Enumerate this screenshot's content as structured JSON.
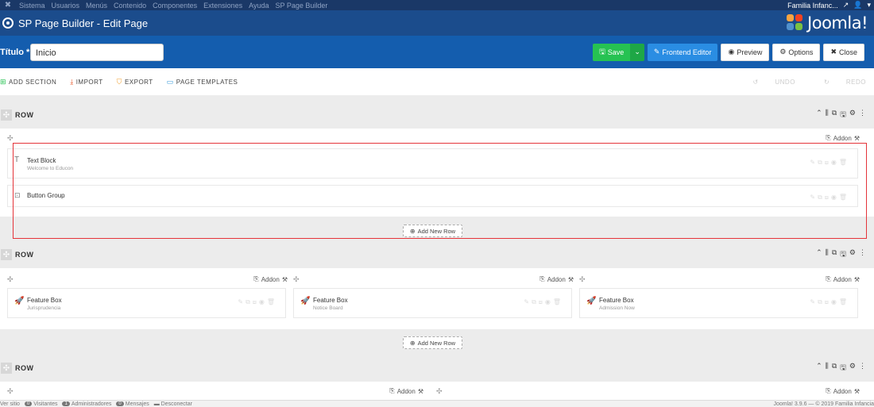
{
  "topmenu": {
    "items": [
      "Sistema",
      "Usuarios",
      "Menús",
      "Contenido",
      "Componentes",
      "Extensiones",
      "Ayuda",
      "SP Page Builder"
    ],
    "site_name": "Familia Infanc...",
    "user_icon": "user-icon"
  },
  "titlebar": {
    "title": "SP Page Builder - Edit Page",
    "logo_text": "Joomla!",
    "logo_colors": [
      "#f9a541",
      "#f44321",
      "#5091cd",
      "#7ac143"
    ]
  },
  "toolbar": {
    "title_label": "Título *",
    "title_value": "Inicio",
    "save_label": "Save",
    "frontend_label": "Frontend Editor",
    "preview_label": "Preview",
    "options_label": "Options",
    "close_label": "Close"
  },
  "actions": {
    "add_section": "ADD SECTION",
    "import": "IMPORT",
    "export": "EXPORT",
    "page_templates": "PAGE TEMPLATES",
    "undo": "UNDO",
    "redo": "REDO"
  },
  "rows": [
    {
      "label": "ROW",
      "addon_label": "Addon",
      "add_row_label": "Add New Row",
      "addons": [
        {
          "title": "Text Block",
          "subtitle": "Welcome to Educon",
          "icon": "text-icon"
        },
        {
          "title": "Button Group",
          "subtitle": "",
          "icon": "button-icon"
        }
      ]
    },
    {
      "label": "ROW",
      "addon_label": "Addon",
      "add_row_label": "Add New Row",
      "columns": [
        {
          "title": "Feature Box",
          "subtitle": "Jurisprudencia"
        },
        {
          "title": "Feature Box",
          "subtitle": "Notice Board"
        },
        {
          "title": "Feature Box",
          "subtitle": "Admission Now"
        }
      ]
    },
    {
      "label": "ROW",
      "addon_label": "Addon"
    }
  ],
  "statusbar": {
    "view_site": "Ver sitio",
    "visitors_count": "0",
    "visitors_label": "Visitantes",
    "admins_count": "1",
    "admins_label": "Administradores",
    "messages_count": "0",
    "messages_label": "Mensajes",
    "logout_label": "Desconectar",
    "footer": "Joomla! 3.9.6 — © 2019 Familia Infancia"
  }
}
